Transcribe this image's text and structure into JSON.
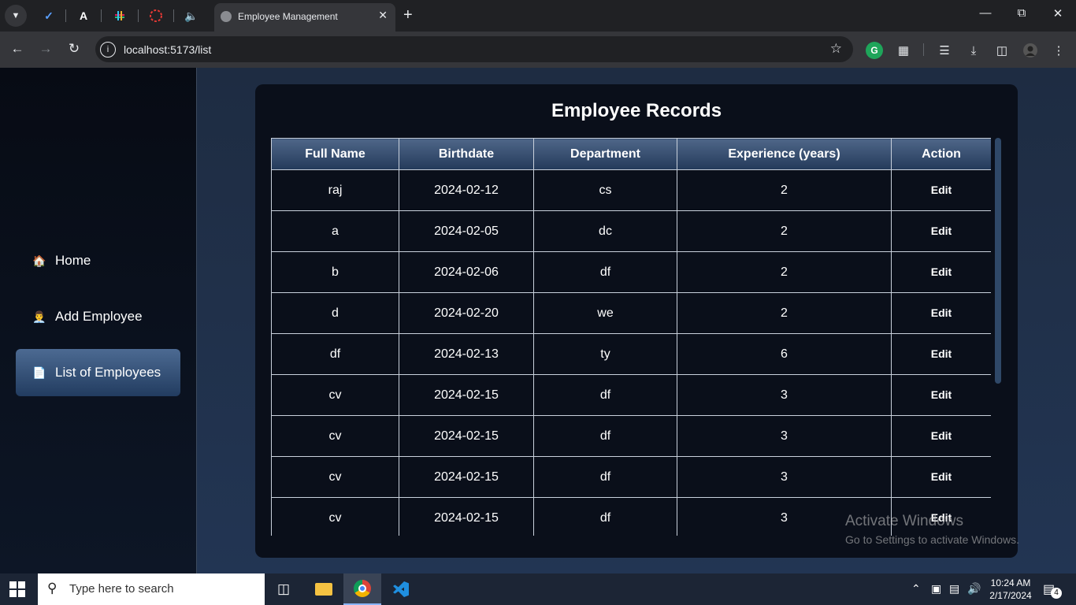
{
  "browser": {
    "tab_title": "Employee Management",
    "url": "localhost:5173/list",
    "pinned_tabs": [
      "todo-check-icon",
      "a-icon",
      "slack-icon",
      "record-icon",
      "speaker-icon"
    ],
    "pinned_a_label": "A"
  },
  "sidebar": {
    "items": [
      {
        "label": "Home",
        "icon": "🏠"
      },
      {
        "label": "Add Employee",
        "icon": "👨‍💼"
      },
      {
        "label": "List of Employees",
        "icon": "📄"
      }
    ],
    "active_index": 2
  },
  "main": {
    "title": "Employee Records",
    "columns": [
      "Full Name",
      "Birthdate",
      "Department",
      "Experience (years)",
      "Action"
    ],
    "rows": [
      {
        "name": "raj",
        "birthdate": "2024-02-12",
        "department": "cs",
        "experience": "2",
        "action": "Edit"
      },
      {
        "name": "a",
        "birthdate": "2024-02-05",
        "department": "dc",
        "experience": "2",
        "action": "Edit"
      },
      {
        "name": "b",
        "birthdate": "2024-02-06",
        "department": "df",
        "experience": "2",
        "action": "Edit"
      },
      {
        "name": "d",
        "birthdate": "2024-02-20",
        "department": "we",
        "experience": "2",
        "action": "Edit"
      },
      {
        "name": "df",
        "birthdate": "2024-02-13",
        "department": "ty",
        "experience": "6",
        "action": "Edit"
      },
      {
        "name": "cv",
        "birthdate": "2024-02-15",
        "department": "df",
        "experience": "3",
        "action": "Edit"
      },
      {
        "name": "cv",
        "birthdate": "2024-02-15",
        "department": "df",
        "experience": "3",
        "action": "Edit"
      },
      {
        "name": "cv",
        "birthdate": "2024-02-15",
        "department": "df",
        "experience": "3",
        "action": "Edit"
      },
      {
        "name": "cv",
        "birthdate": "2024-02-15",
        "department": "df",
        "experience": "3",
        "action": "Edit"
      }
    ]
  },
  "watermark": {
    "line1": "Activate Windows",
    "line2": "Go to Settings to activate Windows."
  },
  "taskbar": {
    "search_placeholder": "Type here to search",
    "time": "10:24 AM",
    "date": "2/17/2024",
    "notification_count": "4"
  },
  "colors": {
    "accent": "#4c6a92",
    "card_bg": "#0a0f1a",
    "page_bg": "#1f2f45"
  }
}
